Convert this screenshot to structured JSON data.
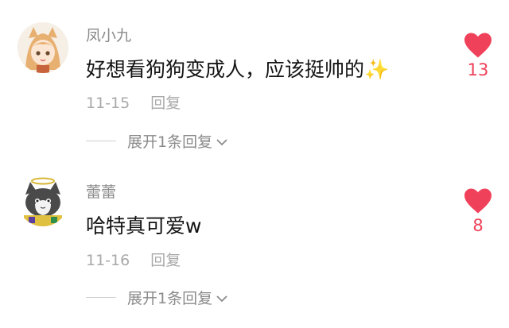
{
  "comments": [
    {
      "username": "凤小九",
      "text": "好想看狗狗变成人，应该挺帅的",
      "emoji": "✨",
      "date": "11-15",
      "reply_label": "回复",
      "likes": "13",
      "expand_label": "展开1条回复",
      "avatar_icon": "anime-girl-avatar"
    },
    {
      "username": "蕾蕾",
      "text": "哈特真可爱w",
      "date": "11-16",
      "reply_label": "回复",
      "likes": "8",
      "expand_label": "展开1条回复",
      "avatar_icon": "cat-angel-avatar"
    }
  ],
  "colors": {
    "like": "#f0415a",
    "muted": "#a9a9a9"
  }
}
